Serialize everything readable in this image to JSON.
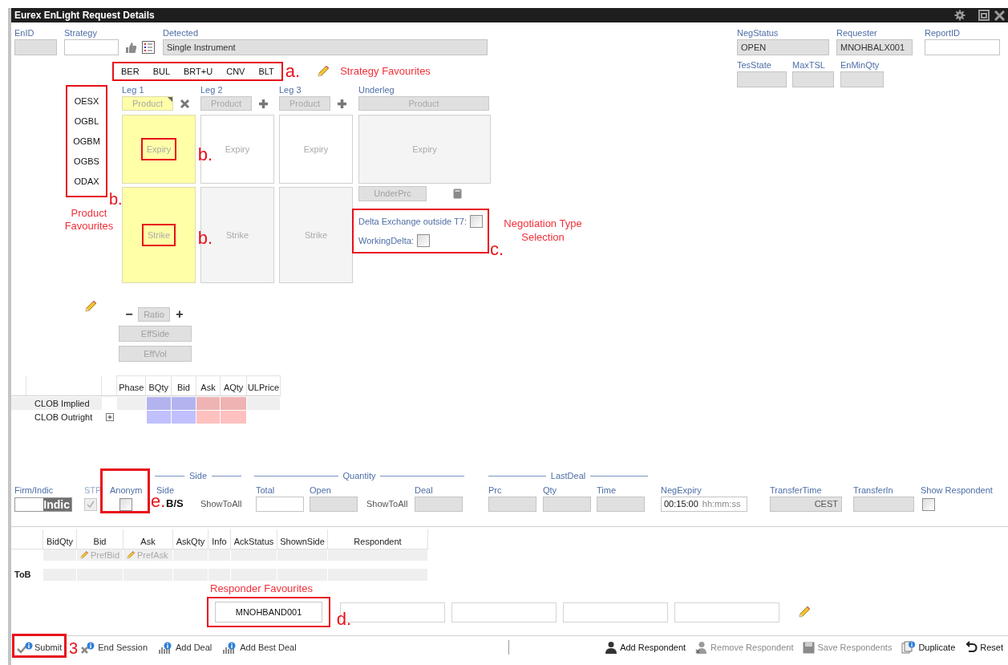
{
  "window": {
    "title": "Eurex EnLight Request Details"
  },
  "header_fields": [
    {
      "label": "EnID",
      "editable": false
    },
    {
      "label": "Strategy",
      "editable": true
    },
    {
      "label": "Detected",
      "value": "Single Instrument",
      "editable": false
    }
  ],
  "status_fields": [
    [
      {
        "label": "NegStatus",
        "value": "OPEN",
        "editable": false
      },
      {
        "label": "Requester",
        "value": "MNOHBALX001",
        "editable": false
      },
      {
        "label": "ReportID",
        "editable": true
      }
    ],
    [
      {
        "label": "TesState",
        "editable": false
      },
      {
        "label": "MaxTSL",
        "editable": false
      },
      {
        "label": "EnMinQty",
        "editable": false
      }
    ]
  ],
  "strategy_favourites": [
    "BER",
    "BUL",
    "BRT+U",
    "CNV",
    "BLT"
  ],
  "product_favourites": [
    "OESX",
    "OGBL",
    "OGBM",
    "OGBS",
    "ODAX"
  ],
  "legs": [
    {
      "label": "Leg 1",
      "product": "Product",
      "expiry": "Expiry",
      "strike": "Strike",
      "selected": true
    },
    {
      "label": "Leg 2",
      "product": "Product",
      "expiry": "Expiry",
      "strike": "Strike",
      "selected": false
    },
    {
      "label": "Leg 3",
      "product": "Product",
      "expiry": "Expiry",
      "strike": "Strike",
      "selected": false
    }
  ],
  "underleg": {
    "label": "Underleg",
    "product": "Product",
    "expiry": "Expiry",
    "price_button": "UnderPrc"
  },
  "negotiation_options": [
    {
      "label": "Delta Exchange outside T7:",
      "checked": false
    },
    {
      "label": "WorkingDelta:",
      "checked": false
    }
  ],
  "ratio": {
    "minus": "−",
    "label": "Ratio",
    "plus": "+"
  },
  "eff_buttons": [
    "EffSide",
    "EffVol"
  ],
  "clob": {
    "columns": [
      "Phase",
      "BQty",
      "Bid",
      "Ask",
      "AQty",
      "ULPrice"
    ],
    "rows": [
      {
        "label": "CLOB Implied",
        "expandable": false
      },
      {
        "label": "CLOB Outright",
        "expandable": true
      }
    ]
  },
  "order": {
    "groups": [
      "Side",
      "Quantity",
      "LastDeal"
    ],
    "items": [
      {
        "kind": "toggle",
        "label": "Firm/Indic",
        "value": "Indic",
        "on": false
      },
      {
        "kind": "checkbox",
        "label": "STP",
        "checked": true,
        "disabled": true
      },
      {
        "kind": "checkbox",
        "label": "Anonym",
        "checked": false,
        "disabled": false
      },
      {
        "kind": "side",
        "label": "Side",
        "value": "B/S"
      },
      {
        "kind": "plain",
        "value": "ShowToAll"
      },
      {
        "kind": "input",
        "label": "Total",
        "editable": true
      },
      {
        "kind": "input",
        "label": "Open",
        "editable": false
      },
      {
        "kind": "plain",
        "value": "ShowToAll"
      },
      {
        "kind": "input",
        "label": "Deal",
        "editable": false
      },
      {
        "kind": "input",
        "label": "Prc",
        "editable": false
      },
      {
        "kind": "input",
        "label": "Qty",
        "editable": false
      },
      {
        "kind": "input",
        "label": "Time",
        "editable": false
      },
      {
        "kind": "time",
        "label": "NegExpiry",
        "value": "00:15:00",
        "format": "hh:mm:ss"
      },
      {
        "kind": "input",
        "label": "TransferTime",
        "value": "CEST",
        "editable": false
      },
      {
        "kind": "input",
        "label": "TransferIn",
        "editable": false
      },
      {
        "kind": "checkbox",
        "label": "Show Respondent",
        "checked": false,
        "disabled": false
      }
    ]
  },
  "respondent_table": {
    "columns": [
      "BidQty",
      "Bid",
      "Ask",
      "AskQty",
      "Info",
      "AckStatus",
      "ShownSide",
      "Respondent"
    ],
    "pref_bid": "PrefBid",
    "pref_ask": "PrefAsk",
    "row_label": "ToB"
  },
  "responder_favourites": [
    "MNOHBAND001"
  ],
  "toolbar_left": [
    {
      "label": "Submit",
      "kind": "submit"
    },
    {
      "label": "End Session",
      "kind": "end"
    },
    {
      "label": "Add Deal",
      "kind": "deal"
    },
    {
      "label": "Add Best Deal",
      "kind": "deal"
    }
  ],
  "toolbar_right": [
    {
      "label": "Add Respondent",
      "kind": "person",
      "disabled": false
    },
    {
      "label": "Remove Respondent",
      "kind": "person-remove",
      "disabled": true
    },
    {
      "label": "Save Respondents",
      "kind": "save",
      "disabled": true
    },
    {
      "label": "Duplicate",
      "kind": "duplicate",
      "disabled": false
    },
    {
      "label": "Reset",
      "kind": "reset",
      "disabled": false
    }
  ],
  "annotations": {
    "strategy_marker": "a.",
    "strategy_note": "Strategy Favourites",
    "product_marker": "b.",
    "product_note": "Product Favourites",
    "expiry_marker": "b.",
    "strike_marker": "b.",
    "negotiation_marker": "c.",
    "negotiation_note": "Negotiation Type Selection",
    "responder_note": "Responder Favourites",
    "responder_marker": "d.",
    "anonym_marker": "e.",
    "submit_marker": "3"
  }
}
